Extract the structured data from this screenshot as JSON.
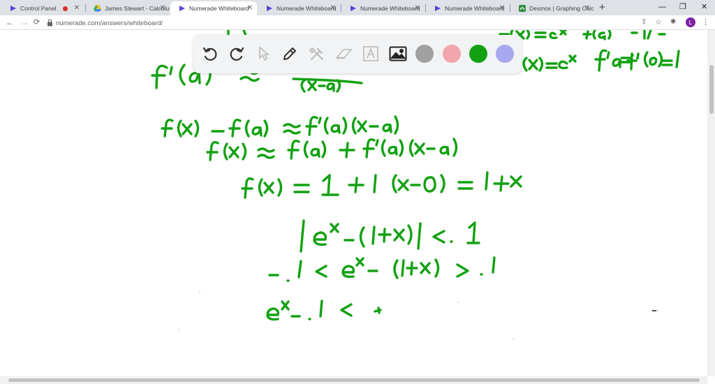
{
  "browser": {
    "tabs": [
      {
        "title": "Control Panel",
        "active": false
      },
      {
        "title": "James Stewart - Calculus",
        "active": false
      },
      {
        "title": "Numerade Whiteboard",
        "active": true
      },
      {
        "title": "Numerade Whiteboard",
        "active": false
      },
      {
        "title": "Numerade Whiteboard",
        "active": false
      },
      {
        "title": "Numerade Whiteboard",
        "active": false
      },
      {
        "title": "Desmos | Graphing Calculator",
        "active": false
      }
    ],
    "url": "numerade.com/answers/whiteboard/",
    "profile_initial": "L"
  },
  "whiteboard_toolbar": {
    "tools": [
      "undo-icon",
      "redo-icon",
      "select-pointer-icon",
      "pen-icon",
      "tools-icon",
      "eraser-icon",
      "text-icon",
      "image-icon"
    ],
    "colors": [
      "#a0a0a0",
      "#f2a5ab",
      "#12a112",
      "#a8a8f0"
    ],
    "selected_color": "#12a112"
  },
  "ink": {
    "color": "#12a112"
  }
}
